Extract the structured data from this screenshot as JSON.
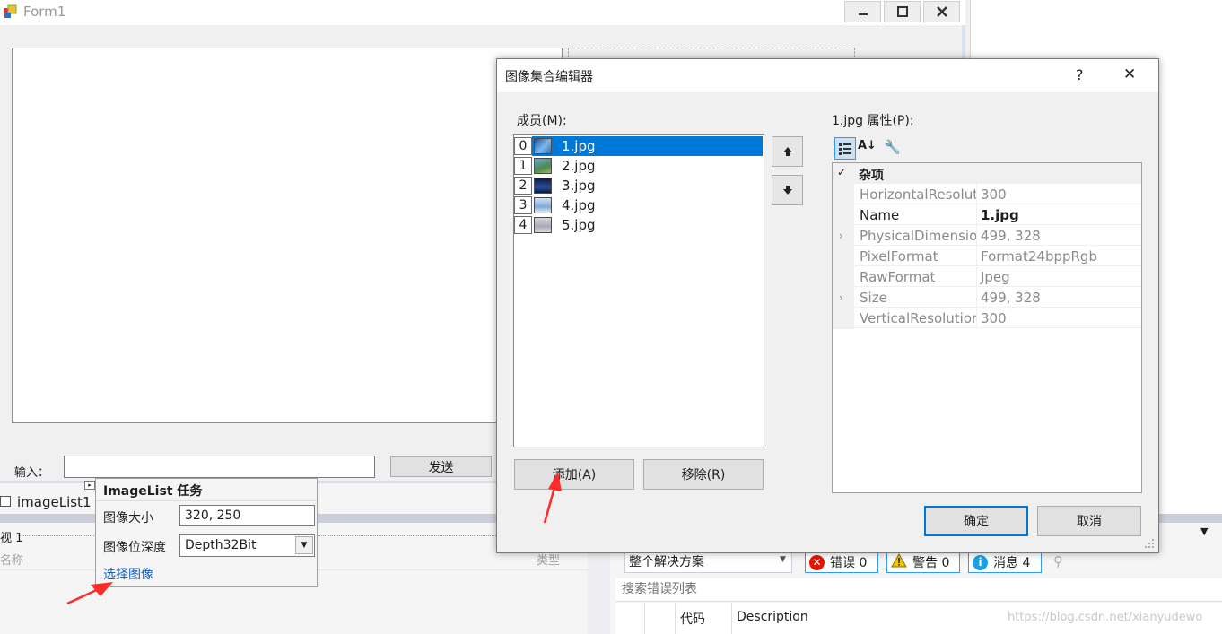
{
  "form": {
    "title": "Form1"
  },
  "designer": {
    "input_label": "输入：",
    "send_label": "发送"
  },
  "tray": {
    "component_label": "imageList1"
  },
  "lower_left": {
    "tab_label": "视 1",
    "col_name": "名称",
    "col_type": "类型"
  },
  "smart_tag": {
    "title": "ImageList 任务",
    "size_label": "图像大小",
    "size_value": "320, 250",
    "depth_label": "图像位深度",
    "depth_value": "Depth32Bit",
    "choose_link": "选择图像"
  },
  "dialog": {
    "title": "图像集合编辑器",
    "help": "?",
    "close": "✕",
    "members_label": "成员(M):",
    "members": [
      {
        "index": "0",
        "name": "1.jpg",
        "selected": true
      },
      {
        "index": "1",
        "name": "2.jpg",
        "selected": false
      },
      {
        "index": "2",
        "name": "3.jpg",
        "selected": false
      },
      {
        "index": "3",
        "name": "4.jpg",
        "selected": false
      },
      {
        "index": "4",
        "name": "5.jpg",
        "selected": false
      }
    ],
    "add_label": "添加(A)",
    "remove_label": "移除(R)",
    "props_label": "1.jpg 属性(P):",
    "category": "杂项",
    "properties": [
      {
        "name": "HorizontalResolut",
        "value": "300"
      },
      {
        "name": "Name",
        "value": "1.jpg"
      },
      {
        "name": "PhysicalDimensior",
        "value": "499, 328"
      },
      {
        "name": "PixelFormat",
        "value": "Format24bppRgb"
      },
      {
        "name": "RawFormat",
        "value": "Jpeg"
      },
      {
        "name": "Size",
        "value": "499, 328"
      },
      {
        "name": "VerticalResolutior",
        "value": "300"
      }
    ],
    "ok_label": "确定",
    "cancel_label": "取消"
  },
  "error_list": {
    "scope": "整个解决方案",
    "errors_label": "错误 0",
    "warnings_label": "警告 0",
    "messages_label": "消息 4",
    "search_placeholder": "搜索错误列表",
    "col_code": "代码",
    "col_desc": "Description"
  },
  "watermark": "https://blog.csdn.net/xianyudewo",
  "colors": {
    "accent": "#0078d7",
    "error": "#e51400",
    "warning": "#f2c500",
    "info": "#1ba1e2"
  }
}
